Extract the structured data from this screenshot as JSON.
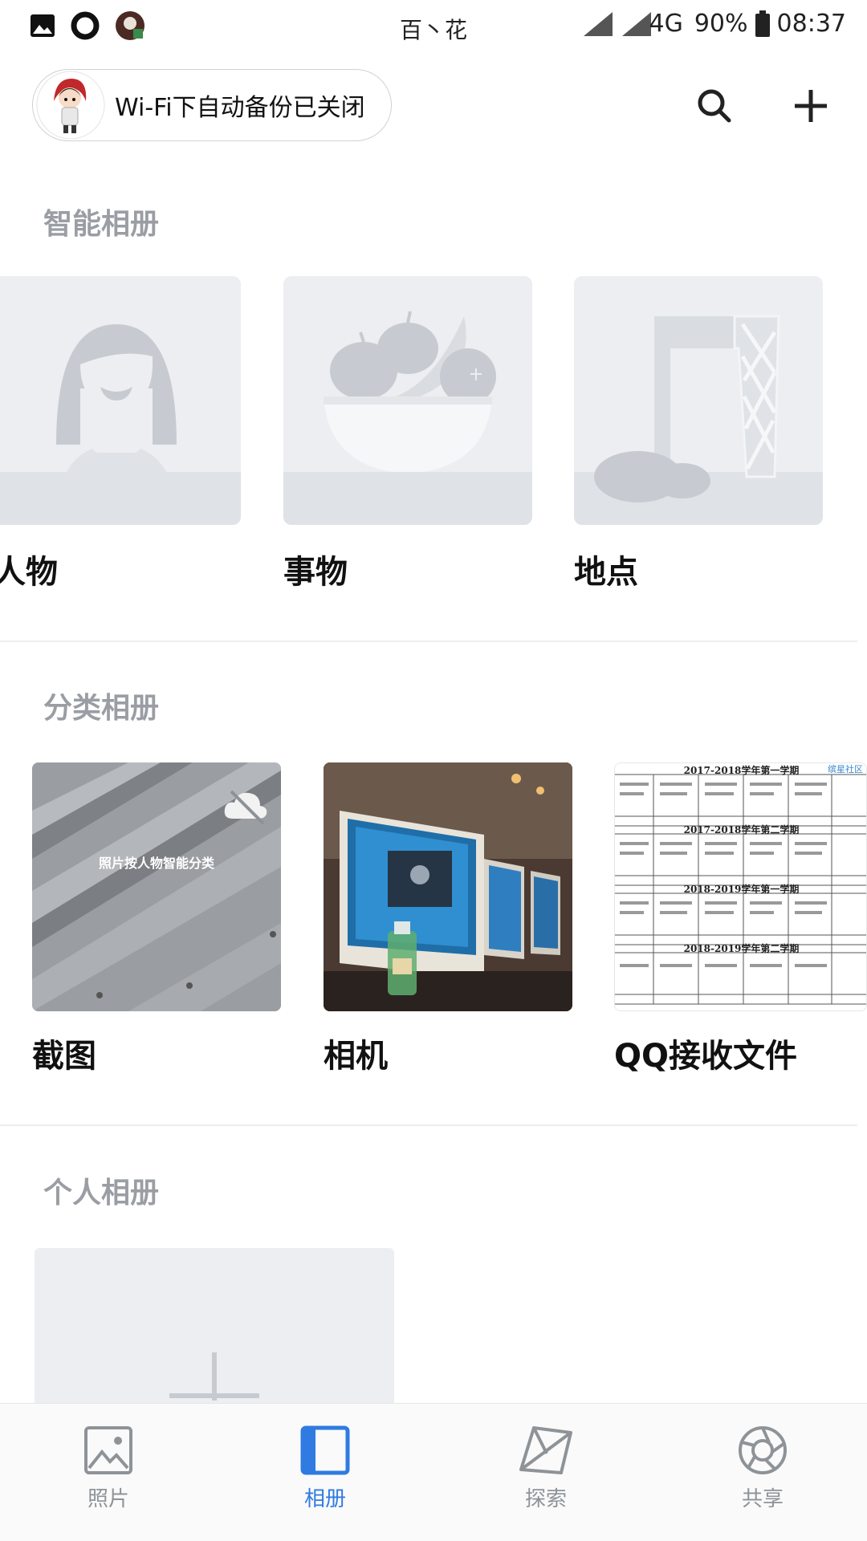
{
  "status_bar": {
    "title": "百丶花",
    "network": "4G",
    "battery": "90%",
    "time": "08:37"
  },
  "header": {
    "backup_status": "Wi-Fi下自动备份已关闭",
    "icons": [
      "search-icon",
      "add-icon"
    ]
  },
  "smart_albums": {
    "title": "智能相册",
    "items": [
      {
        "label": "人物",
        "icon": "person-placeholder-icon"
      },
      {
        "label": "事物",
        "icon": "fruit-bowl-placeholder-icon"
      },
      {
        "label": "地点",
        "icon": "landmark-placeholder-icon"
      }
    ]
  },
  "category_albums": {
    "title": "分类相册",
    "items": [
      {
        "label": "截图",
        "overlay_text": "照片按人物智能分类"
      },
      {
        "label": "相机"
      },
      {
        "label": "QQ接收文件",
        "thumb_header_1": "2017-2018学年第一学期",
        "thumb_header_2": "2017-2018学年第二学期",
        "thumb_header_3": "2018-2019学年第一学期",
        "thumb_header_4": "2018-2019学年第二学期",
        "thumb_watermark": "缤星社区"
      }
    ]
  },
  "personal_albums": {
    "title": "个人相册"
  },
  "bottom_nav": {
    "items": [
      {
        "label": "照片",
        "icon": "photo-icon",
        "active": false
      },
      {
        "label": "相册",
        "icon": "album-icon",
        "active": true
      },
      {
        "label": "探索",
        "icon": "explore-icon",
        "active": false
      },
      {
        "label": "共享",
        "icon": "share-aperture-icon",
        "active": false
      }
    ],
    "active_color": "#2f7be2",
    "inactive_color": "#8e9398"
  }
}
